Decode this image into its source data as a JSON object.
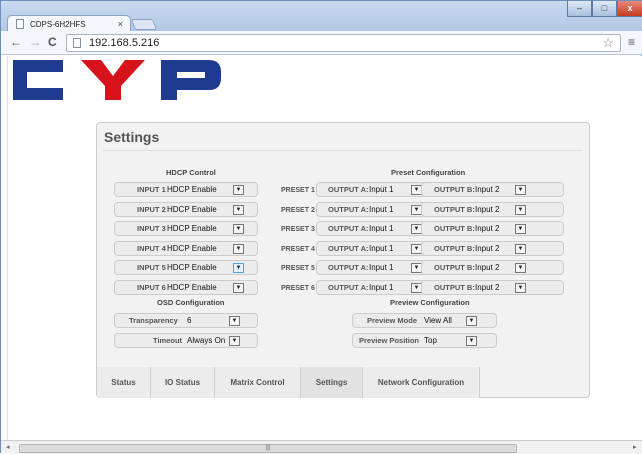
{
  "browser": {
    "tab_title": "CDPS-6H2HFS",
    "tab_close": "×",
    "url": "192.168.5.216",
    "back": "←",
    "forward": "→",
    "reload": "C",
    "star": "☆",
    "menu": "≡",
    "min": "–",
    "max": "□",
    "close": "x"
  },
  "logo": {
    "text": "CYP",
    "colors": [
      "#1f3b8f",
      "#d6131b",
      "#1f3b8f"
    ]
  },
  "settings": {
    "title": "Settings",
    "hdcp_title": "HDCP Control",
    "hdcp_rows": [
      {
        "label": "INPUT 1",
        "value": "HDCP Enable"
      },
      {
        "label": "INPUT 2",
        "value": "HDCP Enable"
      },
      {
        "label": "INPUT 3",
        "value": "HDCP Enable"
      },
      {
        "label": "INPUT 4",
        "value": "HDCP Enable"
      },
      {
        "label": "INPUT 5",
        "value": "HDCP Enable"
      },
      {
        "label": "INPUT 6",
        "value": "HDCP Enable"
      }
    ],
    "preset_title": "Preset Configuration",
    "preset_rows": [
      {
        "label": "PRESET 1",
        "out_a_label": "OUTPUT A:",
        "out_a": "Input 1",
        "out_b_label": "OUTPUT B:",
        "out_b": "Input 2"
      },
      {
        "label": "PRESET 2",
        "out_a_label": "OUTPUT A:",
        "out_a": "Input 1",
        "out_b_label": "OUTPUT B:",
        "out_b": "Input 2"
      },
      {
        "label": "PRESET 3",
        "out_a_label": "OUTPUT A:",
        "out_a": "Input 1",
        "out_b_label": "OUTPUT B:",
        "out_b": "Input 2"
      },
      {
        "label": "PRESET 4",
        "out_a_label": "OUTPUT A:",
        "out_a": "Input 1",
        "out_b_label": "OUTPUT B:",
        "out_b": "Input 2"
      },
      {
        "label": "PRESET 5",
        "out_a_label": "OUTPUT A:",
        "out_a": "Input 1",
        "out_b_label": "OUTPUT B:",
        "out_b": "Input 2"
      },
      {
        "label": "PRESET 6",
        "out_a_label": "OUTPUT A:",
        "out_a": "Input 1",
        "out_b_label": "OUTPUT B:",
        "out_b": "Input 2"
      }
    ],
    "osd_title": "OSD Configuration",
    "transparency_label": "Transparency",
    "transparency_value": "6",
    "timeout_label": "Timeout",
    "timeout_value": "Always On",
    "preview_title": "Preview Configuration",
    "preview_mode_label": "Preview Mode",
    "preview_mode_value": "View All",
    "preview_position_label": "Preview Position",
    "preview_position_value": "Top"
  },
  "tabs": [
    "Status",
    "IO Status",
    "Matrix Control",
    "Settings",
    "Network Configuration"
  ],
  "active_tab": "Settings",
  "scrollbar": {
    "grip": "|||",
    "left": "◂",
    "right": "▸"
  }
}
